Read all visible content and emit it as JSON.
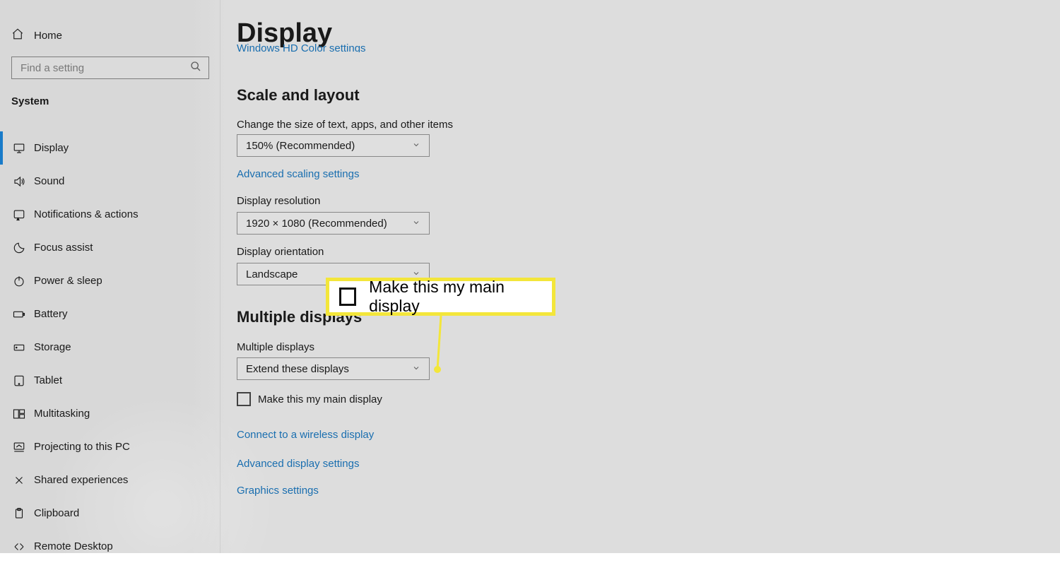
{
  "sidebar": {
    "home_label": "Home",
    "search_placeholder": "Find a setting",
    "category_label": "System",
    "items": [
      {
        "label": "Display",
        "icon": "display-icon",
        "active": true
      },
      {
        "label": "Sound",
        "icon": "sound-icon",
        "active": false
      },
      {
        "label": "Notifications & actions",
        "icon": "notifications-icon",
        "active": false
      },
      {
        "label": "Focus assist",
        "icon": "moon-icon",
        "active": false
      },
      {
        "label": "Power & sleep",
        "icon": "power-icon",
        "active": false
      },
      {
        "label": "Battery",
        "icon": "battery-icon",
        "active": false
      },
      {
        "label": "Storage",
        "icon": "storage-icon",
        "active": false
      },
      {
        "label": "Tablet",
        "icon": "tablet-icon",
        "active": false
      },
      {
        "label": "Multitasking",
        "icon": "multitasking-icon",
        "active": false
      },
      {
        "label": "Projecting to this PC",
        "icon": "projecting-icon",
        "active": false
      },
      {
        "label": "Shared experiences",
        "icon": "shared-icon",
        "active": false
      },
      {
        "label": "Clipboard",
        "icon": "clipboard-icon",
        "active": false
      },
      {
        "label": "Remote Desktop",
        "icon": "remote-icon",
        "active": false
      }
    ]
  },
  "main": {
    "heading": "Display",
    "clipped_link": "Windows HD Color settings",
    "scale": {
      "heading": "Scale and layout",
      "text_size_label": "Change the size of text, apps, and other items",
      "text_size_value": "150% (Recommended)",
      "advanced_link": "Advanced scaling settings",
      "resolution_label": "Display resolution",
      "resolution_value": "1920 × 1080 (Recommended)",
      "orientation_label": "Display orientation",
      "orientation_value": "Landscape"
    },
    "multi": {
      "heading": "Multiple displays",
      "label": "Multiple displays",
      "value": "Extend these displays",
      "main_display_label": "Make this my main display",
      "wireless_link": "Connect to a wireless display",
      "adv_display_link": "Advanced display settings",
      "graphics_link": "Graphics settings"
    }
  },
  "callout": {
    "text": "Make this my main display"
  }
}
